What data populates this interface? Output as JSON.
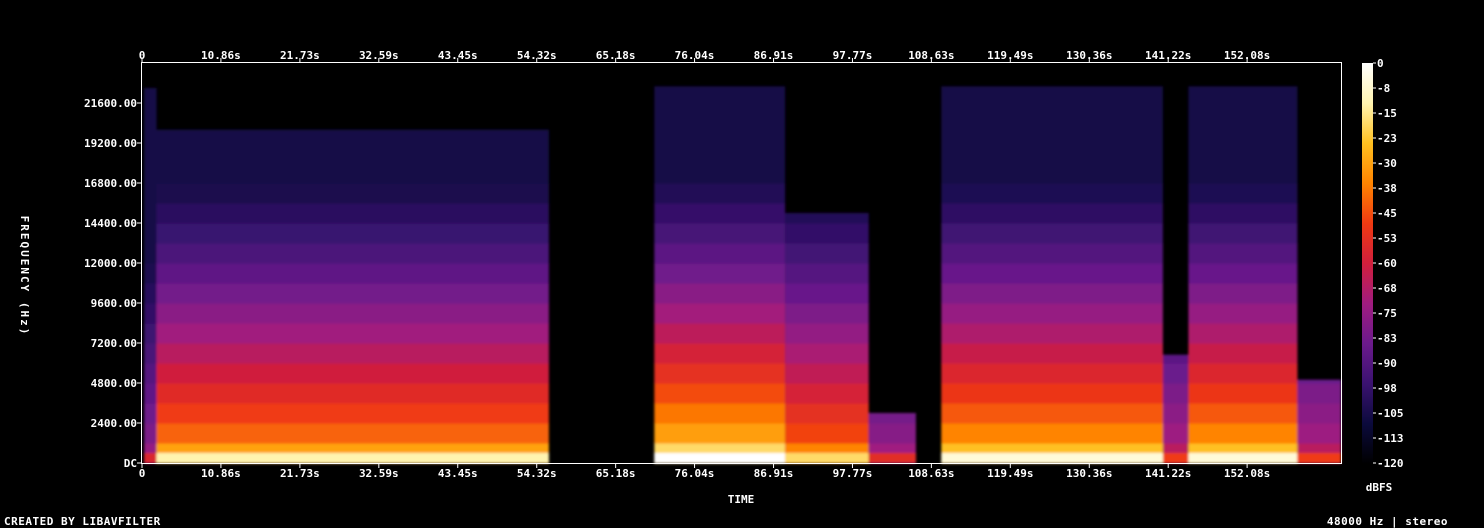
{
  "chart_data": {
    "type": "heatmap",
    "title": "",
    "xlabel": "TIME",
    "ylabel": "FREQUENCY (Hz)",
    "x_ticks": [
      "0",
      "10.86s",
      "21.73s",
      "32.59s",
      "43.45s",
      "54.32s",
      "65.18s",
      "76.04s",
      "86.91s",
      "97.77s",
      "108.63s",
      "119.49s",
      "130.36s",
      "141.22s",
      "152.08s"
    ],
    "x_tick_seconds": [
      0,
      10.86,
      21.73,
      32.59,
      43.45,
      54.32,
      65.18,
      76.04,
      86.91,
      97.77,
      108.63,
      119.49,
      130.36,
      141.22,
      152.08
    ],
    "x_range_seconds": [
      0,
      165
    ],
    "y_ticks": [
      "DC",
      "2400.00",
      "4800.00",
      "7200.00",
      "9600.00",
      "12000.00",
      "14400.00",
      "16800.00",
      "19200.00",
      "21600.00"
    ],
    "y_tick_hz": [
      0,
      2400,
      4800,
      7200,
      9600,
      12000,
      14400,
      16800,
      19200,
      21600
    ],
    "y_range_hz": [
      0,
      24000
    ],
    "colorbar": {
      "label": "dBFS",
      "ticks": [
        "0",
        "-8",
        "-15",
        "-23",
        "-30",
        "-38",
        "-45",
        "-53",
        "-60",
        "-68",
        "-75",
        "-83",
        "-90",
        "-98",
        "-105",
        "-113",
        "-120"
      ],
      "range": [
        -120,
        0
      ],
      "colors": [
        "#000000",
        "#0b0a3c",
        "#3a1270",
        "#6b1a8c",
        "#a01c80",
        "#d11f3c",
        "#f03a12",
        "#ff8400",
        "#ffc020",
        "#fff4b0",
        "#ffffff"
      ]
    },
    "segments": [
      {
        "start": 0.3,
        "end": 2.0,
        "level": 0.38,
        "max_hz": 22500,
        "color_hint": "#7a2a8a"
      },
      {
        "start": 2.0,
        "end": 56.0,
        "level": 0.75,
        "max_hz": 20000
      },
      {
        "start": 70.5,
        "end": 88.5,
        "level": 0.85,
        "max_hz": 22600
      },
      {
        "start": 88.5,
        "end": 100.0,
        "level": 0.7,
        "max_hz": 15000
      },
      {
        "start": 100.0,
        "end": 106.5,
        "level": 0.4,
        "max_hz": 3000
      },
      {
        "start": 110.0,
        "end": 140.5,
        "level": 0.8,
        "max_hz": 22600
      },
      {
        "start": 140.5,
        "end": 144.0,
        "level": 0.45,
        "max_hz": 6500
      },
      {
        "start": 144.0,
        "end": 159.0,
        "level": 0.8,
        "max_hz": 22600
      },
      {
        "start": 159.0,
        "end": 165.0,
        "level": 0.45,
        "max_hz": 5000
      }
    ]
  },
  "footer": {
    "credit": "CREATED BY LIBAVFILTER",
    "format": "48000 Hz | stereo"
  }
}
